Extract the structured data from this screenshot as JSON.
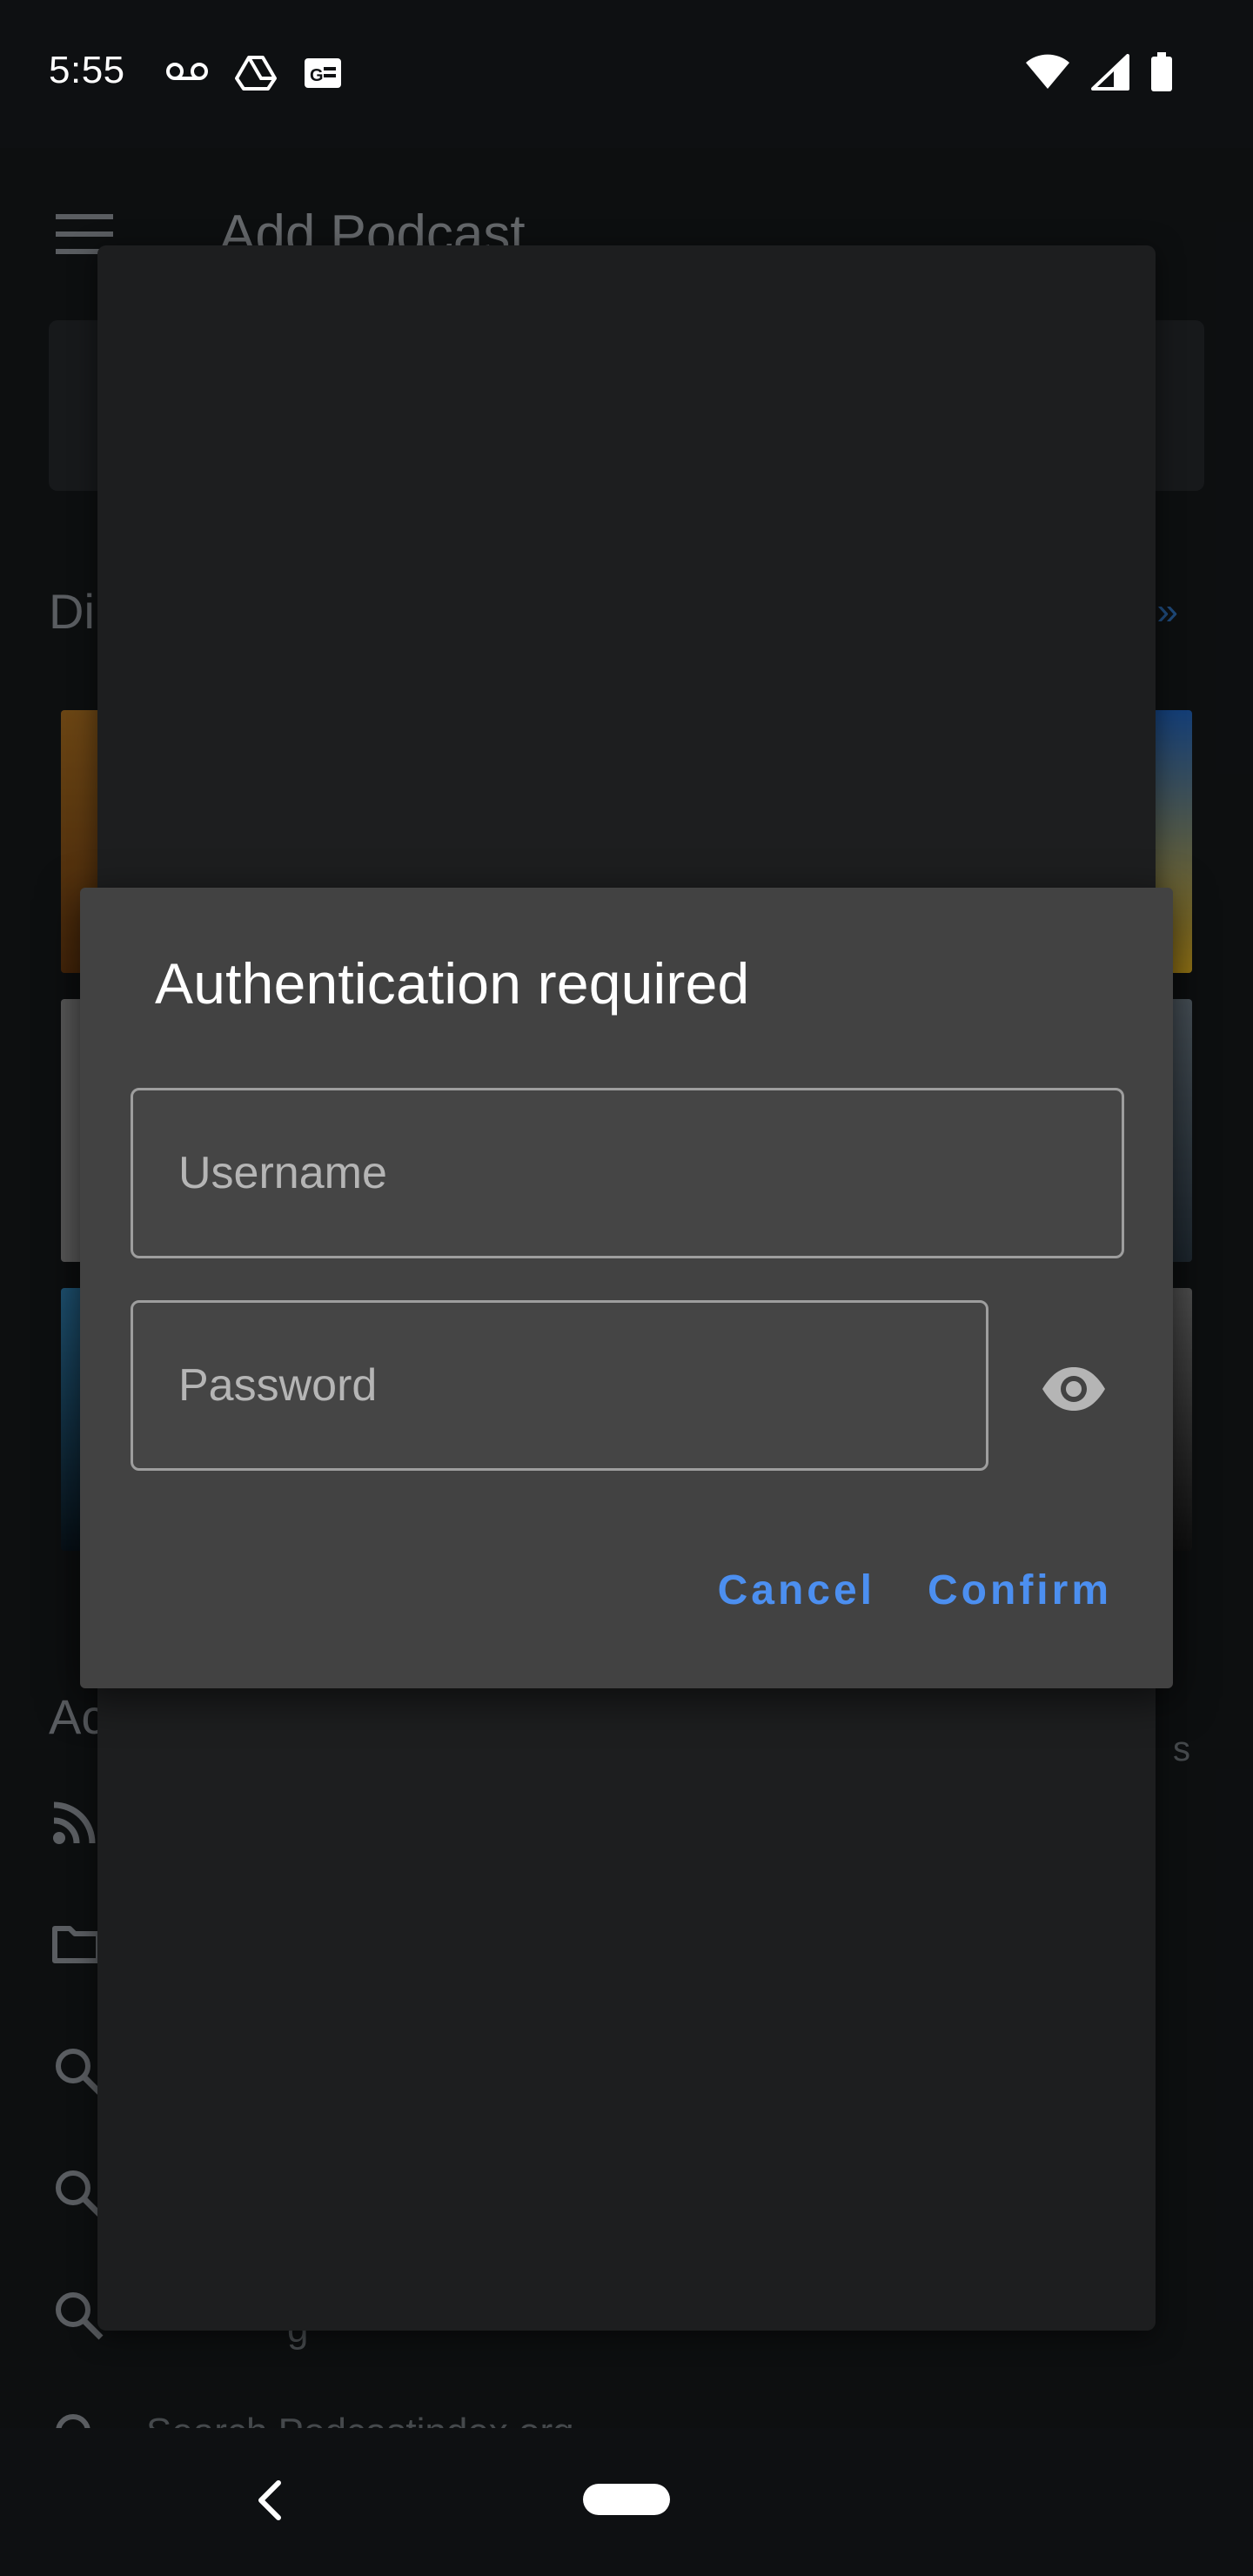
{
  "status_bar": {
    "time": "5:55",
    "icons_left": [
      "voicemail-icon",
      "drive-icon",
      "news-icon"
    ],
    "icons_right": [
      "wifi-icon",
      "signal-icon",
      "battery-icon"
    ]
  },
  "background_app": {
    "title": "Add Podcast",
    "discover_section_label": "Di",
    "more_link": "»",
    "advanced_section_label": "Ac",
    "side_text": "s",
    "list_bottom_text": "Search Podcastindex.org",
    "list_partial_text": "g",
    "list_icons": [
      "rss-icon",
      "folder-icon",
      "search-icon",
      "search-icon",
      "search-icon",
      "search-icon"
    ]
  },
  "dialog": {
    "title": "Authentication required",
    "username_placeholder": "Username",
    "username_value": "",
    "password_placeholder": "Password",
    "password_value": "",
    "cancel_label": "Cancel",
    "confirm_label": "Confirm"
  },
  "colors": {
    "accent": "#4c8ff0",
    "dialog_bg": "#424242",
    "screen_bg": "#14171a"
  }
}
